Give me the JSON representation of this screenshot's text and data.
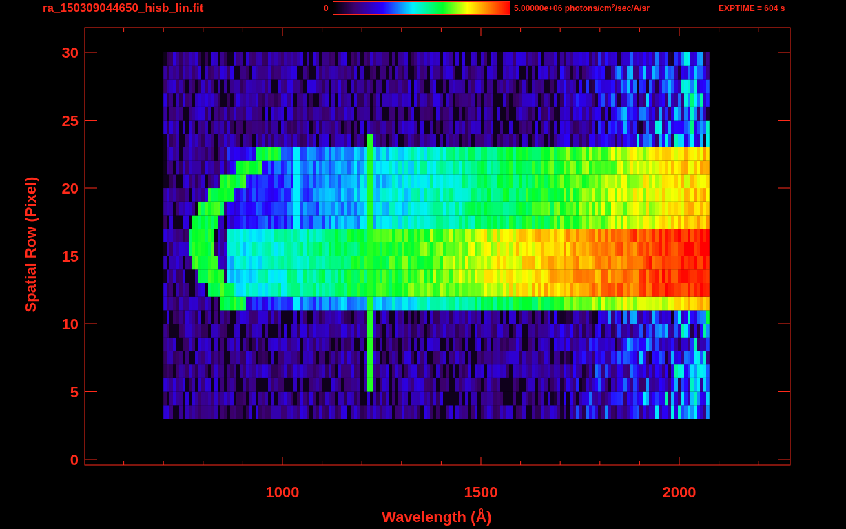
{
  "header": {
    "filename": "ra_150309044650_hisb_lin.fit",
    "colorbar": {
      "min_label": "0",
      "max_label": "5.00000e+06 photons/cm$^{2}$/sec/A/sr"
    },
    "exposure": "EXPTIME = 604 s"
  },
  "plot": {
    "xlabel": "Wavelength (Å)",
    "ylabel": "Spatial Row (Pixel)",
    "xticks": [
      "1000",
      "1500",
      "2000"
    ],
    "yticks": [
      "30",
      "25",
      "20",
      "15",
      "10",
      "5",
      "0"
    ]
  }
}
